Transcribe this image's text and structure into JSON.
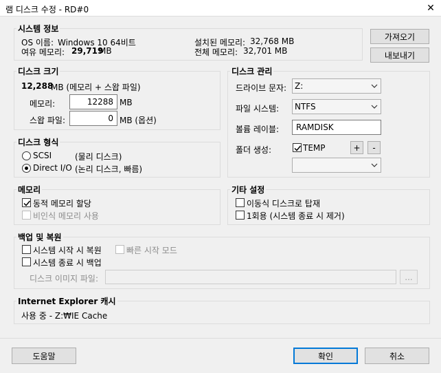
{
  "window": {
    "title": "램 디스크 수정 - RD#0",
    "close_glyph": "✕"
  },
  "system_info": {
    "title": "시스템 정보",
    "os_label": "OS 이름:",
    "os_value": "Windows 10 64비트",
    "free_label": "여유 메모리:",
    "free_value": "29,719",
    "free_unit": "MB",
    "installed_label": "설치된 메모리:",
    "installed_value": "32,768 MB",
    "total_label": "전체 메모리:",
    "total_value": "32,701 MB"
  },
  "side_buttons": {
    "import": "가져오기",
    "export": "내보내기"
  },
  "disk_size": {
    "title": "디스크 크기",
    "total_value": "12,288",
    "total_rest": "MB (메모리 + 스왑 파일)",
    "memory_label": "메모리:",
    "memory_value": "12288",
    "memory_unit": "MB",
    "swap_label": "스왑 파일:",
    "swap_value": "0",
    "swap_unit": "MB (옵션)"
  },
  "disk_type": {
    "title": "디스크 형식",
    "scsi_label": "SCSI",
    "scsi_desc": "(물리 디스크)",
    "scsi_selected": false,
    "direct_label": "Direct I/O",
    "direct_desc": "(논리 디스크, 빠름)",
    "direct_selected": true
  },
  "disk_manage": {
    "title": "디스크 관리",
    "drive_label": "드라이브 문자:",
    "drive_value": "Z:",
    "fs_label": "파일 시스템:",
    "fs_value": "NTFS",
    "volume_label": "볼륨 레이블:",
    "volume_value": "RAMDISK",
    "folder_label": "폴더 생성:",
    "folder_check_label": "TEMP",
    "folder_checked": true,
    "plus": "+",
    "minus": "-",
    "folder_select_value": ""
  },
  "memory": {
    "title": "메모리",
    "dynamic_label": "동적 메모리 할당",
    "dynamic_checked": true,
    "nonpaged_label": "비인식 메모리 사용",
    "nonpaged_checked": false
  },
  "other": {
    "title": "기타 설정",
    "removable_label": "이동식 디스크로 탑재",
    "removable_checked": false,
    "oneuse_label": "1회용 (시스템 종료 시 제거)",
    "oneuse_checked": false
  },
  "backup": {
    "title": "백업 및 복원",
    "restore_label": "시스템 시작 시 복원",
    "restore_checked": false,
    "fast_label": "빠른 시작 모드",
    "fast_checked": false,
    "backup_label": "시스템 종료 시 백업",
    "backup_checked": false,
    "image_label": "디스크 이미지 파일:",
    "image_value": "",
    "browse": "..."
  },
  "ie_cache": {
    "title": "Internet Explorer 캐시",
    "status": "사용 중 - Z:₩IE Cache"
  },
  "footer": {
    "help": "도움말",
    "ok": "확인",
    "cancel": "취소"
  },
  "icons": {
    "check": "check-icon",
    "dropdown": "chevron-down-icon",
    "close": "close-icon"
  }
}
